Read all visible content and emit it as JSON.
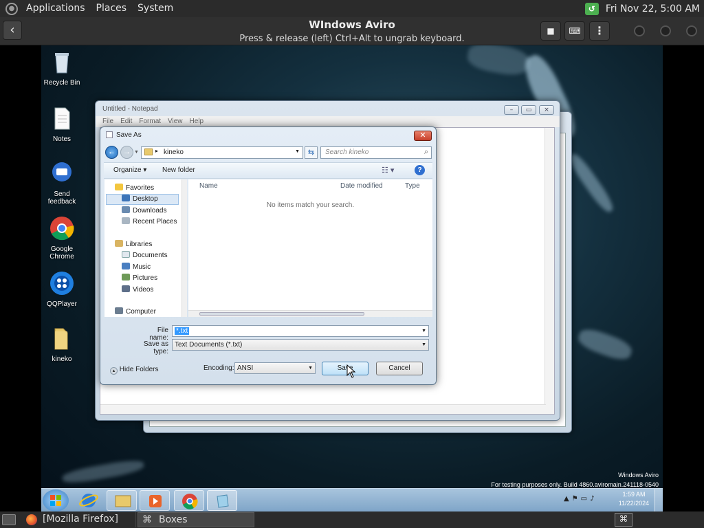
{
  "top_panel": {
    "menus": [
      "Applications",
      "Places",
      "System"
    ],
    "datetime": "Fri Nov 22,  5:00 AM"
  },
  "boxes": {
    "title": "WIndows Aviro",
    "subtitle": "Press & release (left) Ctrl+Alt to ungrab keyboard."
  },
  "desktop_icons": [
    {
      "label": "Recycle Bin"
    },
    {
      "label": "Notes"
    },
    {
      "label": "Send feedback"
    },
    {
      "label": "Google Chrome"
    },
    {
      "label": "QQPlayer"
    },
    {
      "label": "kineko"
    }
  ],
  "notepad": {
    "title": "Untitled - Notepad",
    "menu": [
      "File",
      "Edit",
      "Format",
      "View",
      "Help"
    ]
  },
  "save_as": {
    "title": "Save As",
    "path_segment": "kineko",
    "search_placeholder": "Search kineko",
    "organize": "Organize",
    "new_folder": "New folder",
    "nav": {
      "favorites": "Favorites",
      "desktop": "Desktop",
      "downloads": "Downloads",
      "recent_places": "Recent Places",
      "libraries": "Libraries",
      "documents": "Documents",
      "music": "Music",
      "pictures": "Pictures",
      "videos": "Videos",
      "computer": "Computer"
    },
    "columns": [
      "Name",
      "Date modified",
      "Type"
    ],
    "empty_message": "No items match your search.",
    "file_name_label": "File name:",
    "file_name_value": "*.txt",
    "save_type_label": "Save as type:",
    "save_type_value": "Text Documents (*.txt)",
    "hide_folders": "Hide Folders",
    "encoding_label": "Encoding:",
    "encoding_value": "ANSI",
    "save_button": "Save",
    "cancel_button": "Cancel"
  },
  "watermark": {
    "line1": "Windows Aviro",
    "line2": "For testing purposes only. Build 4860.aviromain.241118-0540"
  },
  "win_taskbar": {
    "time": "1:59 AM",
    "date": "11/22/2024"
  },
  "gnome_bottom": {
    "firefox": "[Mozilla Firefox]",
    "boxes": "Boxes"
  }
}
